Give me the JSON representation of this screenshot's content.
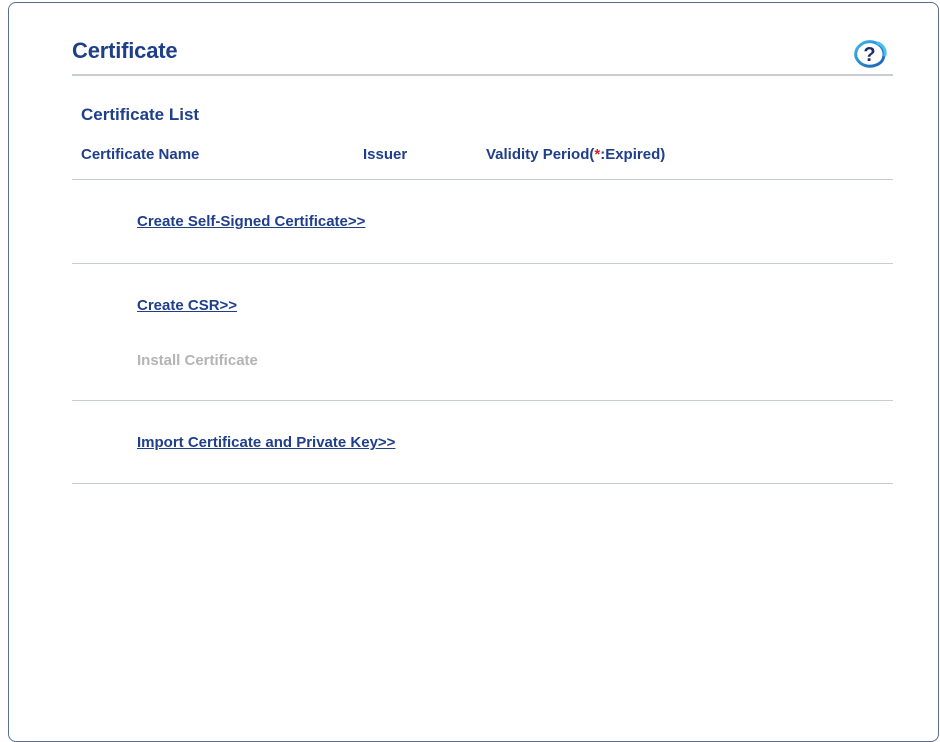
{
  "header": {
    "title": "Certificate",
    "help_icon": "help-question-icon"
  },
  "certificate_list": {
    "title": "Certificate List",
    "columns": {
      "name": "Certificate Name",
      "issuer": "Issuer",
      "validity_prefix": "Validity Period(",
      "validity_asterisk": "*",
      "validity_suffix": ":Expired)"
    }
  },
  "actions": {
    "create_self_signed": "Create Self-Signed Certificate>>",
    "create_csr": "Create CSR>>",
    "install_certificate": "Install Certificate",
    "import_certificate": "Import Certificate and Private Key>>"
  },
  "colors": {
    "accent": "#1f3f8a",
    "disabled": "#b4b4b4",
    "expired_marker": "#e02020",
    "divider": "#c8cdd4"
  }
}
